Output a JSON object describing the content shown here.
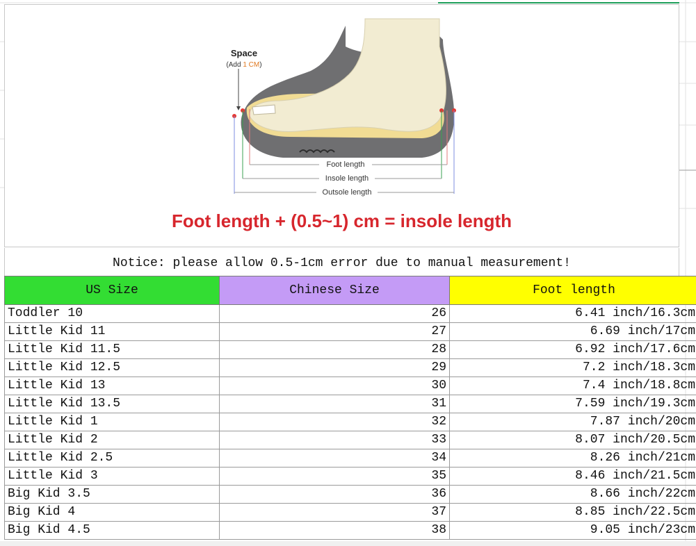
{
  "diagram": {
    "space_label": "Space",
    "space_sub_prefix": "(Add ",
    "space_sub_value": "1 CM",
    "space_sub_suffix": ")",
    "foot_length_label": "Foot length",
    "insole_length_label": "Insole length",
    "outsole_length_label": "Outsole length",
    "formula": "Foot length + (0.5~1) cm = insole length"
  },
  "notice": "Notice: please allow 0.5-1cm error due to manual measurement!",
  "table": {
    "headers": [
      "US Size",
      "Chinese Size",
      "Foot length"
    ],
    "header_colors": [
      "#33dd33",
      "#c49bf6",
      "#ffff00"
    ],
    "rows": [
      {
        "us": "Toddler 10",
        "cn": "26",
        "foot": "6.41 inch/16.3cm"
      },
      {
        "us": "Little Kid 11",
        "cn": "27",
        "foot": "6.69 inch/17cm"
      },
      {
        "us": "Little Kid 11.5",
        "cn": "28",
        "foot": "6.92 inch/17.6cm"
      },
      {
        "us": "Little Kid 12.5",
        "cn": "29",
        "foot": "7.2 inch/18.3cm"
      },
      {
        "us": "Little Kid 13",
        "cn": "30",
        "foot": "7.4 inch/18.8cm"
      },
      {
        "us": "Little Kid 13.5",
        "cn": "31",
        "foot": "7.59 inch/19.3cm"
      },
      {
        "us": "Little Kid 1",
        "cn": "32",
        "foot": "7.87 inch/20cm"
      },
      {
        "us": "Little Kid 2",
        "cn": "33",
        "foot": "8.07 inch/20.5cm"
      },
      {
        "us": "Little Kid 2.5",
        "cn": "34",
        "foot": "8.26 inch/21cm"
      },
      {
        "us": "Little Kid 3",
        "cn": "35",
        "foot": "8.46 inch/21.5cm"
      },
      {
        "us": "Big Kid 3.5",
        "cn": "36",
        "foot": "8.66 inch/22cm"
      },
      {
        "us": "Big Kid 4",
        "cn": "37",
        "foot": "8.85 inch/22.5cm"
      },
      {
        "us": "Big Kid 4.5",
        "cn": "38",
        "foot": "9.05 inch/23cm"
      }
    ]
  }
}
